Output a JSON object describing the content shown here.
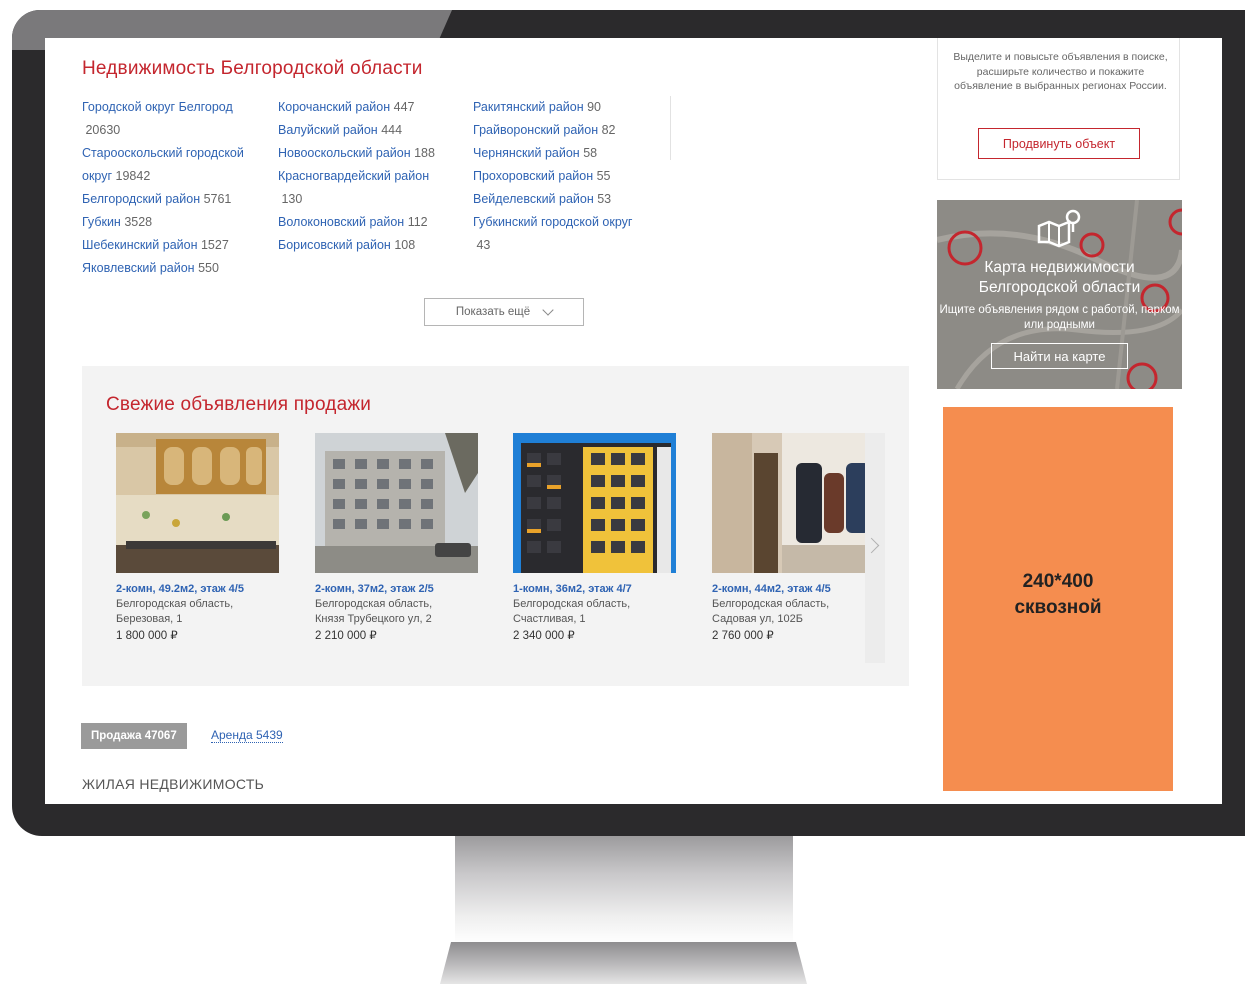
{
  "page_title": "Недвижимость Белгородской области",
  "regions": {
    "col1": [
      {
        "name": "Городской округ Белгород",
        "count": "20630"
      },
      {
        "name": "Старооскольский городской округ",
        "count": "19842"
      },
      {
        "name": "Белгородский район",
        "count": "5761"
      },
      {
        "name": "Губкин",
        "count": "3528"
      },
      {
        "name": "Шебекинский район",
        "count": "1527"
      },
      {
        "name": "Яковлевский район",
        "count": "550"
      }
    ],
    "col2": [
      {
        "name": "Корочанский район",
        "count": "447"
      },
      {
        "name": "Валуйский район",
        "count": "444"
      },
      {
        "name": "Новооскольский район",
        "count": "188"
      },
      {
        "name": "Красногвардейский район",
        "count": "130"
      },
      {
        "name": "Волоконовский район",
        "count": "112"
      },
      {
        "name": "Борисовский район",
        "count": "108"
      }
    ],
    "col3": [
      {
        "name": "Ракитянский район",
        "count": "90"
      },
      {
        "name": "Грайворонский район",
        "count": "82"
      },
      {
        "name": "Чернянский район",
        "count": "58"
      },
      {
        "name": "Прохоровский район",
        "count": "55"
      },
      {
        "name": "Вейделевский район",
        "count": "53"
      },
      {
        "name": "Губкинский городской округ",
        "count": "43"
      }
    ]
  },
  "show_more_label": "Показать ещё",
  "fresh": {
    "title": "Свежие объявления продажи",
    "listings": [
      {
        "title": "2-комн, 49.2м2, этаж 4/5",
        "addr1": "Белгородская область,",
        "addr2": "Березовая, 1",
        "price": "1 800 000 ₽"
      },
      {
        "title": "2-комн, 37м2, этаж 2/5",
        "addr1": "Белгородская область,",
        "addr2": "Князя Трубецкого ул, 2",
        "price": "2 210 000 ₽"
      },
      {
        "title": "1-комн, 36м2, этаж 4/7",
        "addr1": "Белгородская область,",
        "addr2": "Счастливая, 1",
        "price": "2 340 000 ₽"
      },
      {
        "title": "2-комн, 44м2, этаж 4/5",
        "addr1": "Белгородская область,",
        "addr2": "Садовая ул, 102Б",
        "price": "2 760 000 ₽"
      }
    ]
  },
  "tabs": {
    "sale": "Продажа 47067",
    "rent": "Аренда 5439"
  },
  "section_heading": "ЖИЛАЯ НЕДВИЖИМОСТЬ",
  "promo": {
    "text": "Выделите и повысьте объявления в поиске, расширьте количество и покажите объявление в выбранных регионах России.",
    "button": "Продвинуть объект"
  },
  "map": {
    "title": "Карта недвижимости Белгородской области",
    "subtitle": "Ищите объявления рядом с работой, парком или родными",
    "button": "Найти на карте"
  },
  "banner": {
    "line1": "240*400",
    "line2": "сквозной",
    "color": "#f58d4f"
  },
  "colors": {
    "accent_red": "#c4262e",
    "link_blue": "#2f63b3"
  }
}
